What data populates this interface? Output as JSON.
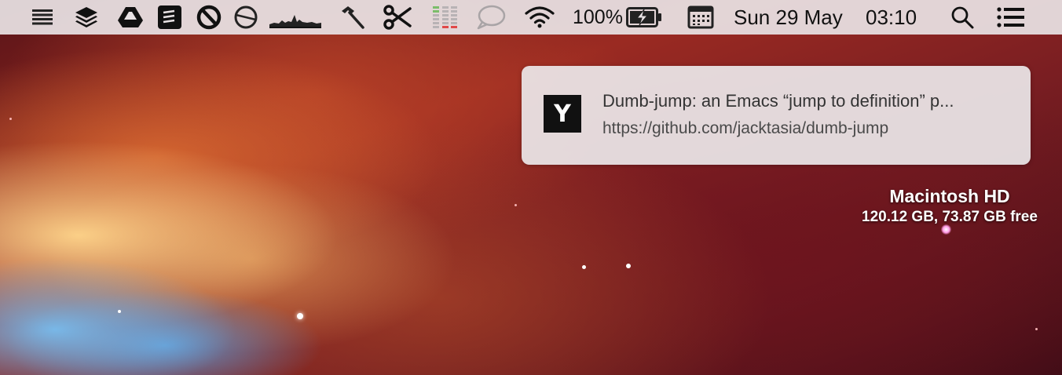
{
  "menubar": {
    "icons": [
      "hamburger-list-icon",
      "layers-stack-icon",
      "google-drive-icon",
      "notebook-icon",
      "no-entry-icon",
      "circle-slash-icon",
      "activity-graph-icon",
      "hammer-icon",
      "scissors-icon",
      "network-bars-icon",
      "speech-bubble-icon",
      "wifi-icon",
      "battery-charging-icon",
      "calendar-icon",
      "spotlight-search-icon",
      "notification-center-icon"
    ],
    "battery_percent": "100%",
    "date": "Sun 29 May",
    "time": "03:10"
  },
  "notification": {
    "app_icon_letter": "Y",
    "title": "Dumb-jump: an Emacs “jump to definition” p...",
    "body": "https://github.com/jacktasia/dumb-jump"
  },
  "disk_widget": {
    "name": "Macintosh HD",
    "info": "120.12 GB, 73.87 GB free"
  },
  "colors": {
    "menubar_bg": "#e8e2e4",
    "notification_bg": "#ece8ea",
    "app_icon_bg": "#111111",
    "battery_fill": "#222222",
    "net_bar_green": "#7bbd6a",
    "net_bar_red": "#e04848"
  }
}
